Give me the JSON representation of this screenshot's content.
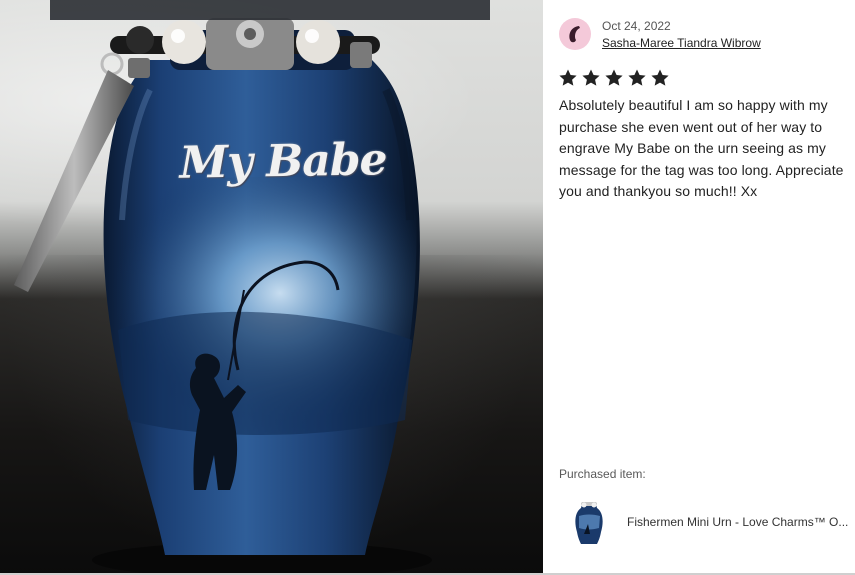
{
  "photo": {
    "engraving_text": "My Babe"
  },
  "review": {
    "date": "Oct 24, 2022",
    "reviewer_name": "Sasha-Maree Tiandra Wibrow",
    "rating": 5,
    "rating_max": 5,
    "text": "Absolutely beautiful I am so happy with my purchase she even went out of her way to engrave My Babe on the urn seeing as my message for the tag was too long. Appreciate you and thankyou so much!! Xx"
  },
  "purchase": {
    "label": "Purchased item:",
    "item_title": "Fishermen Mini Urn - Love Charms™ O..."
  },
  "colors": {
    "avatar_bg": "#f4c9d9",
    "avatar_glyph": "#3a1b2b",
    "star": "#222222",
    "urn_blue": "#1a3a6b"
  },
  "icons": {
    "star": "star-icon",
    "avatar": "avatar"
  }
}
